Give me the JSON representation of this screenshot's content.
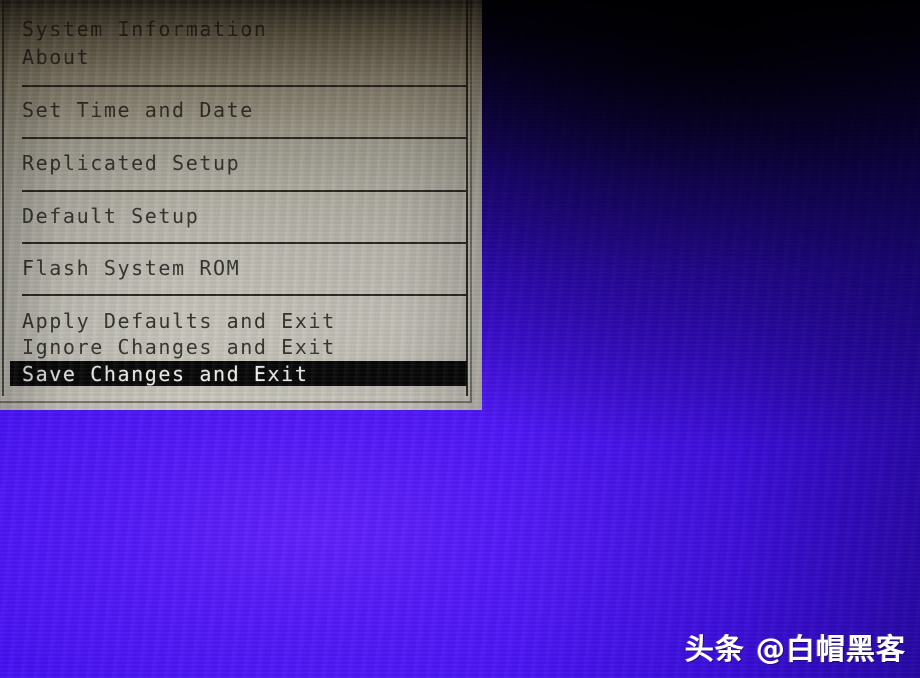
{
  "screen": {
    "background_color": "#2a07e6",
    "panel_color": "#c9c7bd",
    "text_color": "#343430",
    "highlight_bg_color": "#070707",
    "highlight_text_color": "#f2f2ee"
  },
  "menu": {
    "groups": [
      {
        "items": [
          {
            "label": "System Information",
            "selected": false
          },
          {
            "label": "About",
            "selected": false
          }
        ]
      },
      {
        "items": [
          {
            "label": "Set Time and Date",
            "selected": false
          }
        ]
      },
      {
        "items": [
          {
            "label": "Replicated Setup",
            "selected": false
          }
        ]
      },
      {
        "items": [
          {
            "label": "Default Setup",
            "selected": false
          }
        ]
      },
      {
        "items": [
          {
            "label": "Flash System ROM",
            "selected": false
          }
        ]
      },
      {
        "items": [
          {
            "label": "Apply Defaults and Exit",
            "selected": false
          },
          {
            "label": "Ignore Changes and Exit",
            "selected": false
          },
          {
            "label": "Save Changes and Exit",
            "selected": true
          }
        ]
      }
    ]
  },
  "items_flat": {
    "system_information": "System Information",
    "about": "About",
    "set_time_and_date": "Set Time and Date",
    "replicated_setup": "Replicated Setup",
    "default_setup": "Default Setup",
    "flash_system_rom": "Flash System ROM",
    "apply_defaults_and_exit": "Apply Defaults and Exit",
    "ignore_changes_and_exit": "Ignore Changes and Exit",
    "save_changes_and_exit": "Save Changes and Exit"
  },
  "watermark": {
    "text": "头条 @白帽黑客"
  }
}
